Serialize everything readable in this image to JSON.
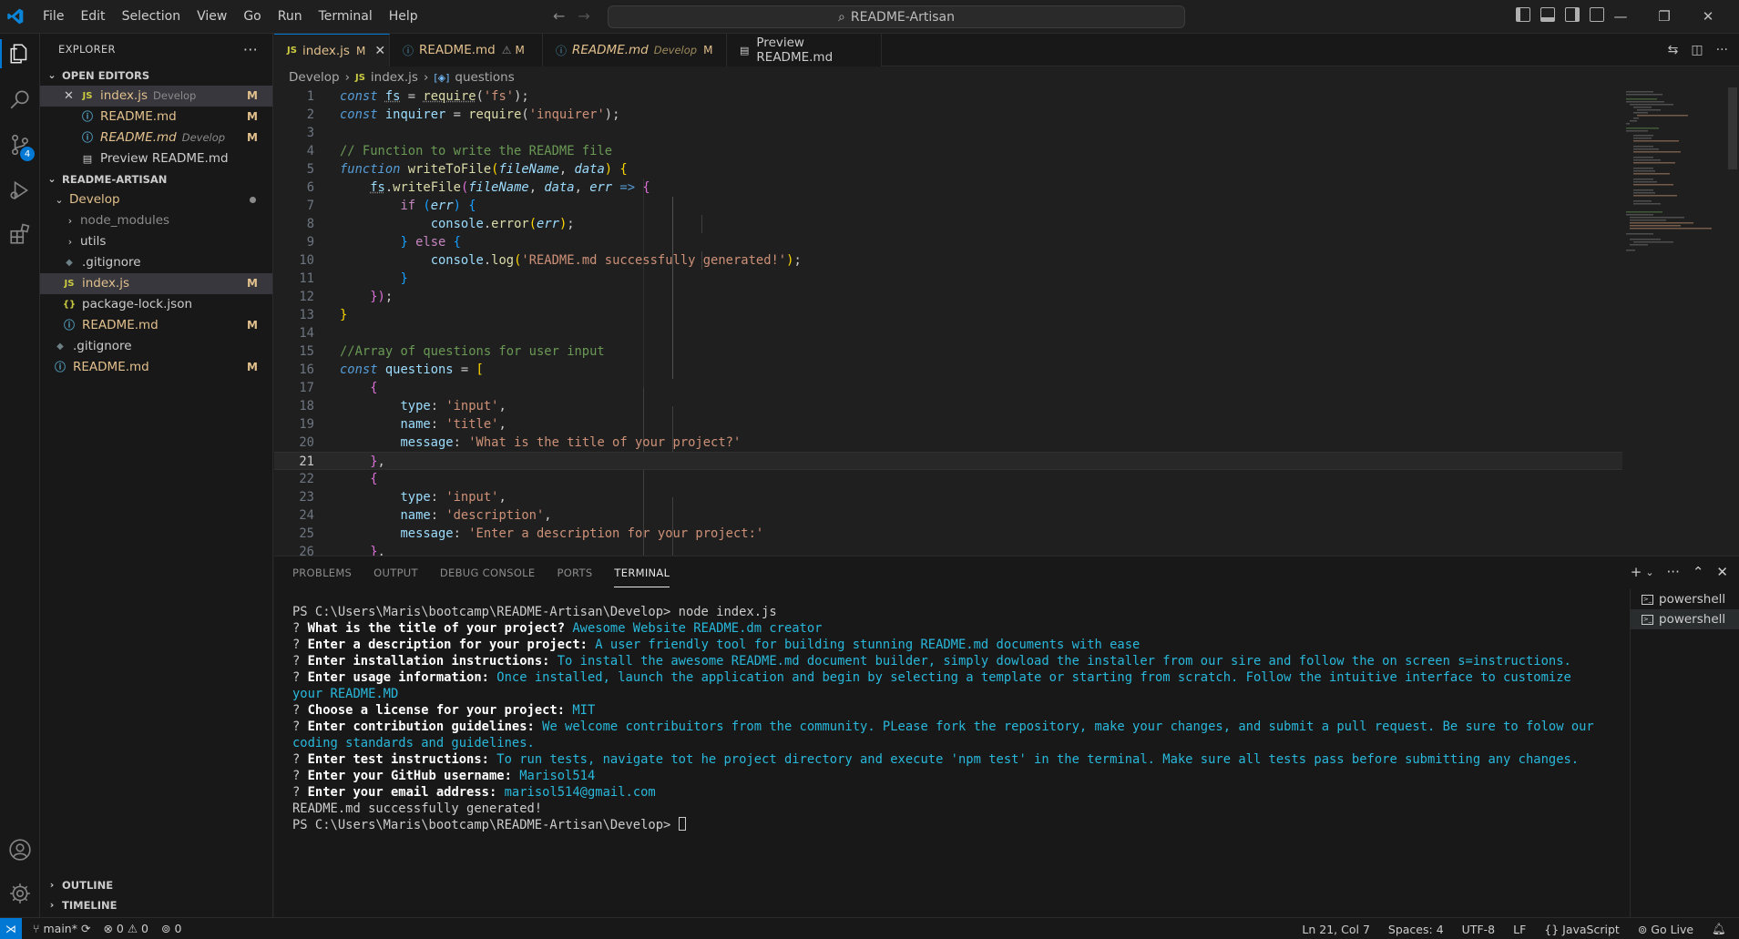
{
  "titlebar": {
    "menu": [
      "File",
      "Edit",
      "Selection",
      "View",
      "Go",
      "Run",
      "Terminal",
      "Help"
    ],
    "search": "README-Artisan"
  },
  "activitybar": {
    "source_control_badge": "4"
  },
  "sidebar": {
    "title": "EXPLORER",
    "open_editors": {
      "header": "OPEN EDITORS",
      "items": [
        {
          "name": "index.js",
          "desc": "Develop",
          "mark": "M",
          "icon": "js-icon"
        },
        {
          "name": "README.md",
          "desc": "",
          "mark": "M",
          "icon": "info-icon"
        },
        {
          "name": "README.md",
          "desc": "Develop",
          "mark": "M",
          "icon": "info-icon"
        },
        {
          "name": "Preview README.md",
          "desc": "",
          "mark": "",
          "icon": "preview-icon"
        }
      ]
    },
    "project": {
      "header": "README-ARTISAN",
      "items": [
        {
          "name": "Develop",
          "mark": ""
        },
        {
          "name": "node_modules",
          "mark": ""
        },
        {
          "name": "utils",
          "mark": ""
        },
        {
          "name": ".gitignore",
          "mark": ""
        },
        {
          "name": "index.js",
          "mark": "M"
        },
        {
          "name": "package-lock.json",
          "mark": ""
        },
        {
          "name": "README.md",
          "mark": "M"
        },
        {
          "name": ".gitignore",
          "mark": ""
        },
        {
          "name": "README.md",
          "mark": "M"
        }
      ]
    },
    "outline": "OUTLINE",
    "timeline": "TIMELINE"
  },
  "tabs": [
    {
      "label": "index.js",
      "mark": "M"
    },
    {
      "label": "README.md",
      "mark": "M"
    },
    {
      "label": "README.md",
      "desc": "Develop",
      "mark": "M"
    },
    {
      "label": "Preview README.md"
    }
  ],
  "breadcrumb": {
    "folder": "Develop",
    "file": "index.js",
    "symbol": "questions"
  },
  "editor": {
    "line_numbers": [
      "1",
      "2",
      "3",
      "4",
      "5",
      "6",
      "7",
      "8",
      "9",
      "10",
      "11",
      "12",
      "13",
      "14",
      "15",
      "16",
      "17",
      "18",
      "19",
      "20",
      "21",
      "22",
      "23",
      "24",
      "25",
      "26"
    ],
    "current_line": "21"
  },
  "panel": {
    "tabs": [
      "PROBLEMS",
      "OUTPUT",
      "DEBUG CONSOLE",
      "PORTS",
      "TERMINAL"
    ],
    "shells": [
      "powershell",
      "powershell"
    ],
    "terminal": {
      "cmd_prompt": "PS C:\\Users\\Maris\\bootcamp\\README-Artisan\\Develop> ",
      "cmd": "node index.js",
      "qa": [
        {
          "q": "What is the title of your project?",
          "a": "Awesome Website README.dm creator"
        },
        {
          "q": "Enter a description for your project:",
          "a": "A user friendly tool for building stunning README.md documents with ease"
        },
        {
          "q": "Enter installation instructions:",
          "a": "To install the awesome README.md document builder, simply dowload the installer from our sire and follow the on screen s=instructions."
        },
        {
          "q": "Enter usage information:",
          "a": "Once installed, launch the application and begin by selecting a template or starting from scratch. Follow the intuitive interface to customize your README.MD"
        },
        {
          "q": "Choose a license for your project:",
          "a": "MIT"
        },
        {
          "q": "Enter contribution guidelines:",
          "a": "We welcome contribuitors from the community. PLease fork the repository, make your changes, and submit a pull request. Be sure to folow our coding standards and guidelines."
        },
        {
          "q": "Enter test instructions:",
          "a": "To run tests, navigate tot he project directory and execute 'npm test' in the terminal. Make sure all tests pass before submitting any changes."
        },
        {
          "q": "Enter your GitHub username:",
          "a": "Marisol514"
        },
        {
          "q": "Enter your email address:",
          "a": "marisol514@gmail.com"
        }
      ],
      "success": "README.md successfully generated!",
      "final_prompt": "PS C:\\Users\\Maris\\bootcamp\\README-Artisan\\Develop> "
    }
  },
  "statusbar": {
    "branch": "main*",
    "errors": "0",
    "warnings": "0",
    "ports": "0",
    "position": "Ln 21, Col 7",
    "spaces": "Spaces: 4",
    "encoding": "UTF-8",
    "eol": "LF",
    "language": "JavaScript",
    "golive": "Go Live"
  }
}
